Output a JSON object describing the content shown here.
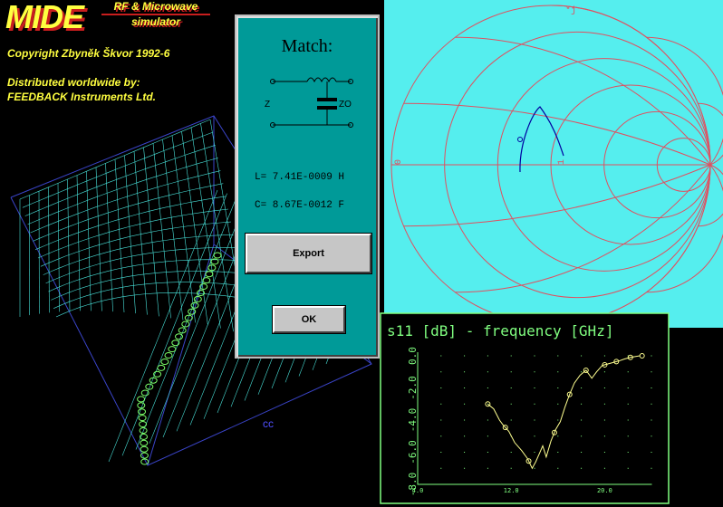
{
  "app": {
    "logo": "MIDE",
    "subtitle_line1": "RF & Microwave",
    "subtitle_line2": "simulator",
    "copyright": "Copyright Zbyněk Škvor 1992-6",
    "distributed_line1": "Distributed worldwide by:",
    "distributed_line2": "FEEDBACK Instruments Ltd."
  },
  "surface": {
    "axis_label": "cc",
    "trace_color": "#7cff6a",
    "mesh_color": "#48e0d8"
  },
  "dialog": {
    "title": "Match:",
    "port_left": "Z",
    "port_right": "ZO",
    "inductance": "L= 7.41E-0009 H",
    "capacitance": "C= 8.67E-0012 F",
    "export_label": "Export",
    "ok_label": "OK",
    "colors": {
      "background": "#009a98",
      "button": "#c6c6c6"
    }
  },
  "smith": {
    "marker_label": "*j",
    "label_zero": "0",
    "label_one": "1",
    "colors": {
      "background": "#55eeee",
      "grid": "#e05060",
      "trace": "#0000a0"
    }
  },
  "chart_data": {
    "type": "line",
    "title": "s11 [dB] - frequency [GHz]",
    "xlabel": "",
    "ylabel": "",
    "xlim": [
      4.0,
      24.0
    ],
    "ylim": [
      -8.0,
      0.0
    ],
    "x_ticks": [
      "4.0",
      "12.0",
      "20.0"
    ],
    "y_ticks": [
      "0.0",
      "-2.0",
      "-4.0",
      "-6.0",
      "-8.0"
    ],
    "grid": "dotted",
    "series": [
      {
        "values_x": [
          10.0,
          10.5,
          11.0,
          11.3,
          11.8,
          12.3,
          12.9,
          13.4,
          13.8,
          14.1,
          14.4,
          14.7,
          15.0,
          15.4,
          15.8,
          16.2,
          16.6,
          17.0,
          17.4,
          17.9,
          18.4,
          18.9,
          19.3,
          19.8,
          20.3,
          20.8,
          21.3,
          21.7,
          22.2,
          22.6,
          23.0
        ],
        "values_y": [
          -3.0,
          -3.3,
          -4.0,
          -4.3,
          -4.7,
          -5.4,
          -5.9,
          -6.4,
          -7.0,
          -6.6,
          -6.1,
          -5.6,
          -6.3,
          -5.3,
          -4.6,
          -4.1,
          -3.2,
          -2.4,
          -1.7,
          -1.2,
          -0.9,
          -1.4,
          -1.0,
          -0.6,
          -0.5,
          -0.4,
          -0.3,
          -0.2,
          -0.1,
          -0.05,
          0.0
        ]
      }
    ],
    "markers_x": [
      10.0,
      11.5,
      13.5,
      15.7,
      17.0,
      18.4,
      20.0,
      21.0,
      22.2,
      23.2
    ],
    "colors": {
      "frame": "#80ff80",
      "trace": "#ffff90",
      "marker": "#ffff90",
      "text": "#80ff80"
    }
  }
}
